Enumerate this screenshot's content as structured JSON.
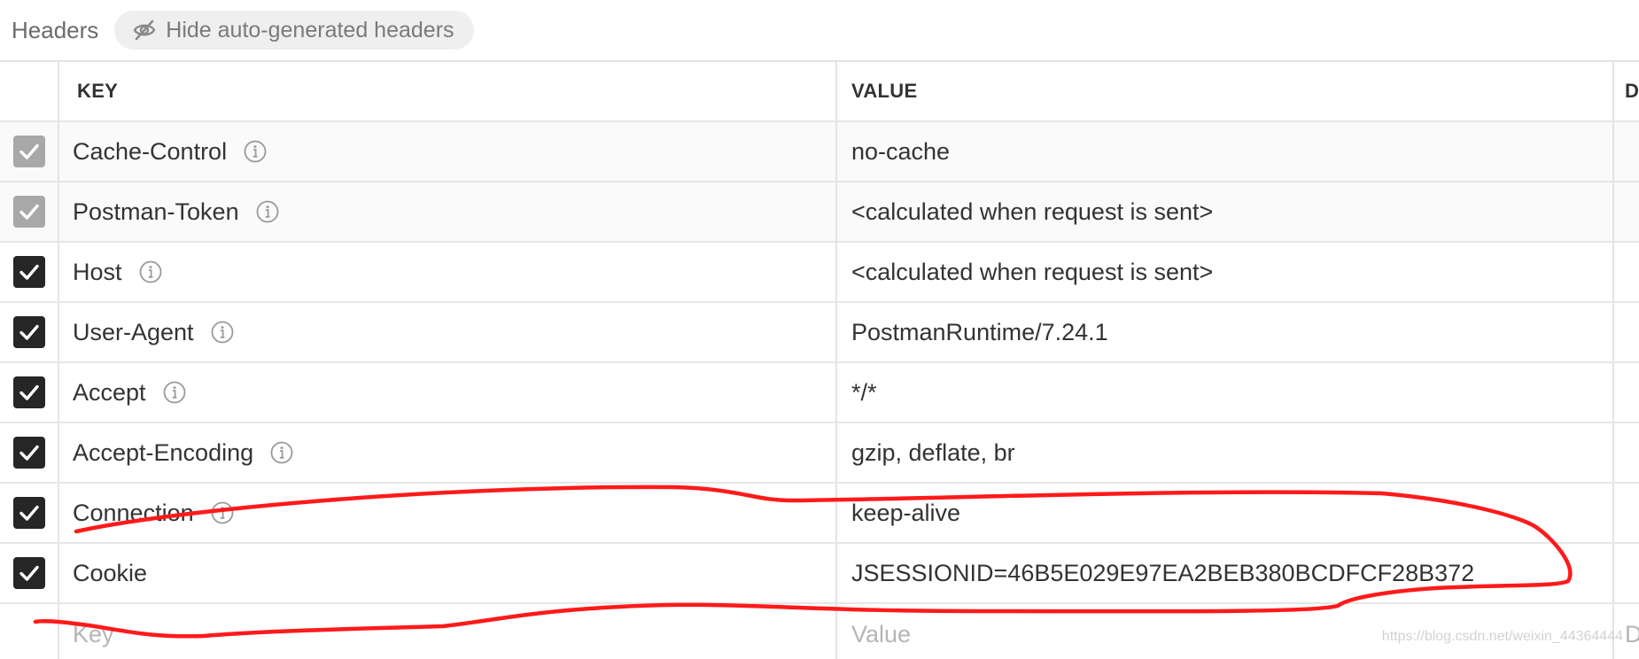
{
  "header": {
    "title": "Headers",
    "toggle_label": "Hide auto-generated headers",
    "toggle_icon": "eye-slash-icon"
  },
  "table": {
    "columns": {
      "key": "KEY",
      "value": "VALUE",
      "description": "D"
    },
    "rows": [
      {
        "key": "Cache-Control",
        "value": "no-cache",
        "checked": true,
        "auto": true,
        "info": true
      },
      {
        "key": "Postman-Token",
        "value": "<calculated when request is sent>",
        "checked": true,
        "auto": true,
        "info": true
      },
      {
        "key": "Host",
        "value": "<calculated when request is sent>",
        "checked": true,
        "auto": false,
        "info": true
      },
      {
        "key": "User-Agent",
        "value": "PostmanRuntime/7.24.1",
        "checked": true,
        "auto": false,
        "info": true
      },
      {
        "key": "Accept",
        "value": "*/*",
        "checked": true,
        "auto": false,
        "info": true
      },
      {
        "key": "Accept-Encoding",
        "value": "gzip, deflate, br",
        "checked": true,
        "auto": false,
        "info": true
      },
      {
        "key": "Connection",
        "value": "keep-alive",
        "checked": true,
        "auto": false,
        "info": true
      },
      {
        "key": "Cookie",
        "value": "JSESSIONID=46B5E029E97EA2BEB380BCDFCF28B372",
        "checked": true,
        "auto": false,
        "info": false
      }
    ],
    "new_row": {
      "key_placeholder": "Key",
      "value_placeholder": "Value",
      "description_placeholder": "D"
    }
  },
  "colors": {
    "annotation": "#ff1a1a",
    "checkbox_user": "#262626",
    "checkbox_auto": "#a8a8a8"
  },
  "watermark": "https://blog.csdn.net/weixin_44364444"
}
